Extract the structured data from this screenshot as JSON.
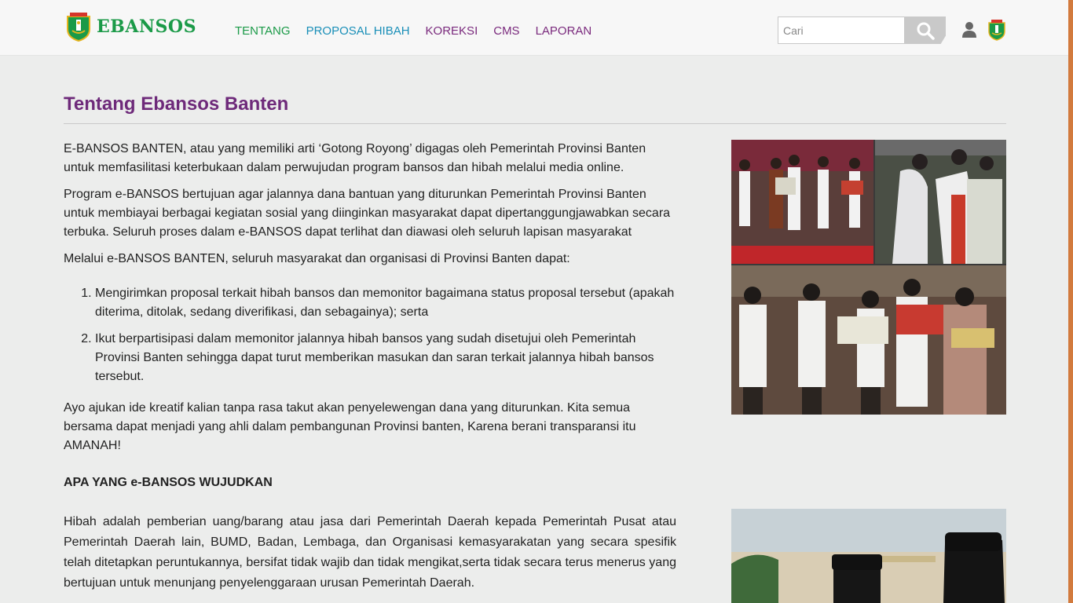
{
  "header": {
    "logo_text": "EBANSOS",
    "nav": [
      {
        "label": "TENTANG",
        "color": "#1b9a48"
      },
      {
        "label": "PROPOSAL HIBAH",
        "color": "#1a8fb8"
      },
      {
        "label": "KOREKSI",
        "color": "#7a2a7d"
      },
      {
        "label": "CMS",
        "color": "#7a2a7d"
      },
      {
        "label": "LAPORAN",
        "color": "#7a2a7d"
      }
    ],
    "search_placeholder": "Cari",
    "icons": [
      "search-icon",
      "user-icon",
      "banten-emblem-icon"
    ]
  },
  "main": {
    "title": "Tentang Ebansos Banten",
    "paragraphs": [
      "E-BANSOS BANTEN, atau yang memiliki arti ‘Gotong Royong’ digagas oleh Pemerintah Provinsi Banten untuk memfasilitasi keterbukaan dalam perwujudan program bansos dan hibah melalui media online.",
      "Program e-BANSOS bertujuan agar jalannya dana bantuan yang diturunkan Pemerintah Provinsi Banten untuk membiayai berbagai kegiatan sosial yang diinginkan masyarakat dapat dipertanggungjawabkan secara terbuka. Seluruh proses dalam e-BANSOS dapat terlihat dan diawasi oleh seluruh lapisan masyarakat",
      "Melalui e-BANSOS BANTEN, seluruh masyarakat dan organisasi di Provinsi Banten dapat:"
    ],
    "list": [
      "Mengirimkan proposal terkait hibah bansos dan memonitor bagaimana status proposal tersebut (apakah diterima, ditolak, sedang diverifikasi, dan sebagainya); serta",
      "Ikut berpartisipasi dalam memonitor jalannya hibah bansos yang sudah disetujui oleh Pemerintah Provinsi Banten sehingga dapat turut memberikan masukan dan saran terkait jalannya hibah bansos tersebut."
    ],
    "closing": "Ayo ajukan ide kreatif kalian tanpa rasa takut akan penyelewengan dana yang diturunkan. Kita semua bersama dapat menjadi yang ahli dalam pembangunan Provinsi banten, Karena berani transparansi itu AMANAH!",
    "section_heading": "APA YANG e-BANSOS WUJUDKAN",
    "section_paragraph": "Hibah adalah pemberian uang/barang atau jasa dari Pemerintah Daerah kepada Pemerintah Pusat atau Pemerintah Daerah lain, BUMD, Badan, Lembaga, dan Organisasi kemasyarakatan yang secara spesifik telah ditetapkan peruntukannya,  bersifat tidak wajib dan tidak mengikat,serta tidak secara terus menerus yang bertujuan untuk menunjang penyelenggaraan urusan Pemerintah Daerah."
  },
  "colors": {
    "title": "#6e2a7a",
    "brand_green": "#1b9a48",
    "accent_orange": "#d27a3d"
  }
}
